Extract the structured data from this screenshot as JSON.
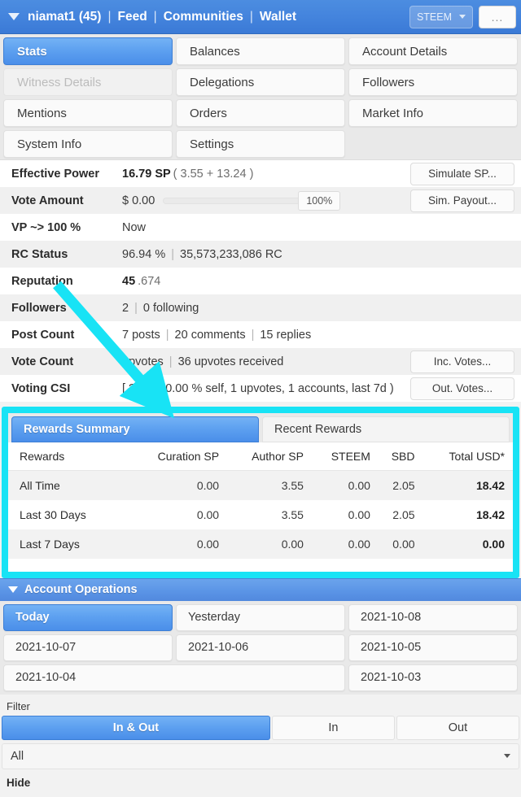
{
  "navbar": {
    "caret_icon": "chevron-down-icon",
    "username": "niamat1 (45)",
    "links": [
      "Feed",
      "Communities",
      "Wallet"
    ],
    "separator": "|",
    "currency_select": "STEEM",
    "overflow_label": "..."
  },
  "main_tabs": [
    {
      "label": "Stats",
      "state": "active"
    },
    {
      "label": "Balances",
      "state": "normal"
    },
    {
      "label": "Account Details",
      "state": "normal"
    },
    {
      "label": "Witness Details",
      "state": "disabled"
    },
    {
      "label": "Delegations",
      "state": "normal"
    },
    {
      "label": "Followers",
      "state": "normal"
    },
    {
      "label": "Mentions",
      "state": "normal"
    },
    {
      "label": "Orders",
      "state": "normal"
    },
    {
      "label": "Market Info",
      "state": "normal"
    },
    {
      "label": "System Info",
      "state": "normal"
    },
    {
      "label": "Settings",
      "state": "normal"
    },
    {
      "label": "",
      "state": "empty"
    }
  ],
  "stats": {
    "effective_power": {
      "label": "Effective Power",
      "value_strong": "16.79 SP",
      "value_muted": "( 3.55 + 13.24 )",
      "button": "Simulate SP..."
    },
    "vote_amount": {
      "label": "Vote Amount",
      "value": "$ 0.00",
      "slider_percent": "100%",
      "button": "Sim. Payout..."
    },
    "vp_to_100": {
      "label": "VP ~> 100 %",
      "value": "Now"
    },
    "rc_status": {
      "label": "RC Status",
      "percent": "96.94 %",
      "rc": "35,573,233,086 RC"
    },
    "reputation": {
      "label": "Reputation",
      "value_strong": "45",
      "value_muted": ".674"
    },
    "followers": {
      "label": "Followers",
      "count": "2",
      "following": "0 following"
    },
    "post_count": {
      "label": "Post Count",
      "posts": "7 posts",
      "comments": "20 comments",
      "replies": "15 replies"
    },
    "vote_count": {
      "label": "Vote Count",
      "given": "upvotes",
      "received": "36 upvotes received",
      "button": "Inc. Votes..."
    },
    "voting_csi": {
      "label": "Voting CSI",
      "value": "[ ? ] ( 100.00 % self, 1 upvotes, 1 accounts, last 7d )",
      "button": "Out. Votes..."
    }
  },
  "rewards": {
    "tabs": [
      {
        "label": "Rewards Summary",
        "state": "active"
      },
      {
        "label": "Recent Rewards",
        "state": "normal"
      }
    ],
    "columns": [
      "Rewards",
      "Curation SP",
      "Author SP",
      "STEEM",
      "SBD",
      "Total USD*"
    ],
    "rows": [
      {
        "period": "All Time",
        "curation_sp": "0.00",
        "author_sp": "3.55",
        "steem": "0.00",
        "sbd": "2.05",
        "total_usd": "18.42"
      },
      {
        "period": "Last 30 Days",
        "curation_sp": "0.00",
        "author_sp": "3.55",
        "steem": "0.00",
        "sbd": "2.05",
        "total_usd": "18.42"
      },
      {
        "period": "Last 7 Days",
        "curation_sp": "0.00",
        "author_sp": "0.00",
        "steem": "0.00",
        "sbd": "0.00",
        "total_usd": "0.00"
      }
    ]
  },
  "account_operations": {
    "header": "Account Operations",
    "caret_icon": "chevron-down-icon",
    "date_tabs": [
      {
        "label": "Today",
        "state": "active"
      },
      {
        "label": "Yesterday",
        "state": "normal"
      },
      {
        "label": "2021-10-08",
        "state": "normal"
      },
      {
        "label": "2021-10-07",
        "state": "normal"
      },
      {
        "label": "2021-10-06",
        "state": "normal"
      },
      {
        "label": "2021-10-05",
        "state": "normal"
      },
      {
        "label": "2021-10-04",
        "state": "wide"
      },
      {
        "label": "2021-10-03",
        "state": "normal"
      }
    ]
  },
  "filter": {
    "label": "Filter",
    "segments": [
      {
        "label": "In & Out",
        "state": "active"
      },
      {
        "label": "In",
        "state": "normal"
      },
      {
        "label": "Out",
        "state": "normal"
      }
    ],
    "dropdown_value": "All",
    "hide_label": "Hide"
  },
  "annotation": {
    "highlight_color": "#18e3f5",
    "arrow_color": "#18e3f5"
  }
}
